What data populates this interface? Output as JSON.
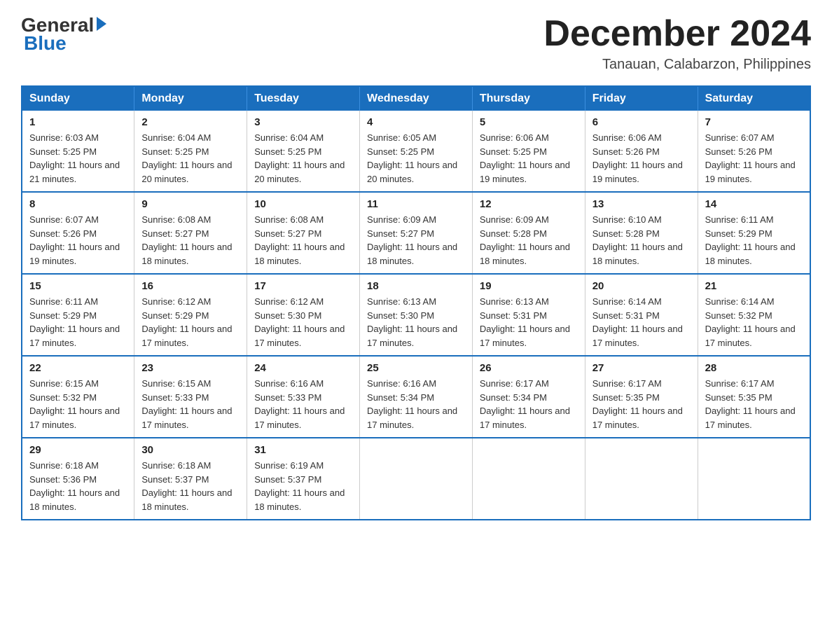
{
  "header": {
    "logo_general": "General",
    "logo_blue": "Blue",
    "month_year": "December 2024",
    "location": "Tanauan, Calabarzon, Philippines"
  },
  "days_of_week": [
    "Sunday",
    "Monday",
    "Tuesday",
    "Wednesday",
    "Thursday",
    "Friday",
    "Saturday"
  ],
  "weeks": [
    [
      {
        "day": "1",
        "sunrise": "6:03 AM",
        "sunset": "5:25 PM",
        "daylight": "11 hours and 21 minutes."
      },
      {
        "day": "2",
        "sunrise": "6:04 AM",
        "sunset": "5:25 PM",
        "daylight": "11 hours and 20 minutes."
      },
      {
        "day": "3",
        "sunrise": "6:04 AM",
        "sunset": "5:25 PM",
        "daylight": "11 hours and 20 minutes."
      },
      {
        "day": "4",
        "sunrise": "6:05 AM",
        "sunset": "5:25 PM",
        "daylight": "11 hours and 20 minutes."
      },
      {
        "day": "5",
        "sunrise": "6:06 AM",
        "sunset": "5:25 PM",
        "daylight": "11 hours and 19 minutes."
      },
      {
        "day": "6",
        "sunrise": "6:06 AM",
        "sunset": "5:26 PM",
        "daylight": "11 hours and 19 minutes."
      },
      {
        "day": "7",
        "sunrise": "6:07 AM",
        "sunset": "5:26 PM",
        "daylight": "11 hours and 19 minutes."
      }
    ],
    [
      {
        "day": "8",
        "sunrise": "6:07 AM",
        "sunset": "5:26 PM",
        "daylight": "11 hours and 19 minutes."
      },
      {
        "day": "9",
        "sunrise": "6:08 AM",
        "sunset": "5:27 PM",
        "daylight": "11 hours and 18 minutes."
      },
      {
        "day": "10",
        "sunrise": "6:08 AM",
        "sunset": "5:27 PM",
        "daylight": "11 hours and 18 minutes."
      },
      {
        "day": "11",
        "sunrise": "6:09 AM",
        "sunset": "5:27 PM",
        "daylight": "11 hours and 18 minutes."
      },
      {
        "day": "12",
        "sunrise": "6:09 AM",
        "sunset": "5:28 PM",
        "daylight": "11 hours and 18 minutes."
      },
      {
        "day": "13",
        "sunrise": "6:10 AM",
        "sunset": "5:28 PM",
        "daylight": "11 hours and 18 minutes."
      },
      {
        "day": "14",
        "sunrise": "6:11 AM",
        "sunset": "5:29 PM",
        "daylight": "11 hours and 18 minutes."
      }
    ],
    [
      {
        "day": "15",
        "sunrise": "6:11 AM",
        "sunset": "5:29 PM",
        "daylight": "11 hours and 17 minutes."
      },
      {
        "day": "16",
        "sunrise": "6:12 AM",
        "sunset": "5:29 PM",
        "daylight": "11 hours and 17 minutes."
      },
      {
        "day": "17",
        "sunrise": "6:12 AM",
        "sunset": "5:30 PM",
        "daylight": "11 hours and 17 minutes."
      },
      {
        "day": "18",
        "sunrise": "6:13 AM",
        "sunset": "5:30 PM",
        "daylight": "11 hours and 17 minutes."
      },
      {
        "day": "19",
        "sunrise": "6:13 AM",
        "sunset": "5:31 PM",
        "daylight": "11 hours and 17 minutes."
      },
      {
        "day": "20",
        "sunrise": "6:14 AM",
        "sunset": "5:31 PM",
        "daylight": "11 hours and 17 minutes."
      },
      {
        "day": "21",
        "sunrise": "6:14 AM",
        "sunset": "5:32 PM",
        "daylight": "11 hours and 17 minutes."
      }
    ],
    [
      {
        "day": "22",
        "sunrise": "6:15 AM",
        "sunset": "5:32 PM",
        "daylight": "11 hours and 17 minutes."
      },
      {
        "day": "23",
        "sunrise": "6:15 AM",
        "sunset": "5:33 PM",
        "daylight": "11 hours and 17 minutes."
      },
      {
        "day": "24",
        "sunrise": "6:16 AM",
        "sunset": "5:33 PM",
        "daylight": "11 hours and 17 minutes."
      },
      {
        "day": "25",
        "sunrise": "6:16 AM",
        "sunset": "5:34 PM",
        "daylight": "11 hours and 17 minutes."
      },
      {
        "day": "26",
        "sunrise": "6:17 AM",
        "sunset": "5:34 PM",
        "daylight": "11 hours and 17 minutes."
      },
      {
        "day": "27",
        "sunrise": "6:17 AM",
        "sunset": "5:35 PM",
        "daylight": "11 hours and 17 minutes."
      },
      {
        "day": "28",
        "sunrise": "6:17 AM",
        "sunset": "5:35 PM",
        "daylight": "11 hours and 17 minutes."
      }
    ],
    [
      {
        "day": "29",
        "sunrise": "6:18 AM",
        "sunset": "5:36 PM",
        "daylight": "11 hours and 18 minutes."
      },
      {
        "day": "30",
        "sunrise": "6:18 AM",
        "sunset": "5:37 PM",
        "daylight": "11 hours and 18 minutes."
      },
      {
        "day": "31",
        "sunrise": "6:19 AM",
        "sunset": "5:37 PM",
        "daylight": "11 hours and 18 minutes."
      },
      null,
      null,
      null,
      null
    ]
  ],
  "labels": {
    "sunrise_prefix": "Sunrise: ",
    "sunset_prefix": "Sunset: ",
    "daylight_prefix": "Daylight: "
  }
}
